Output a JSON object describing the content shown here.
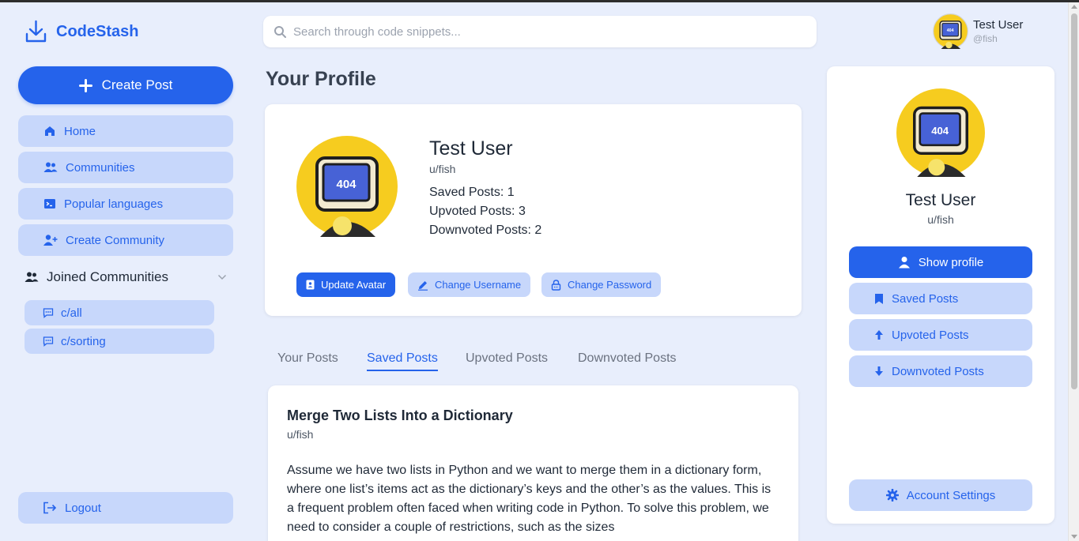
{
  "app": {
    "name": "CodeStash"
  },
  "sidebar": {
    "create_post": "Create Post",
    "nav": [
      {
        "label": "Home",
        "icon": "home-icon"
      },
      {
        "label": "Communities",
        "icon": "users-icon"
      },
      {
        "label": "Popular languages",
        "icon": "terminal-icon"
      },
      {
        "label": "Create Community",
        "icon": "user-plus-icon"
      }
    ],
    "joined_title": "Joined Communities",
    "communities": [
      "c/all",
      "c/sorting"
    ],
    "logout": "Logout"
  },
  "search": {
    "placeholder": "Search through code snippets..."
  },
  "top_user": {
    "name": "Test User",
    "handle": "@fish"
  },
  "page_title": "Your Profile",
  "profile": {
    "name": "Test User",
    "handle": "u/fish",
    "saved": "Saved Posts: 1",
    "upvoted": "Upvoted Posts: 3",
    "downvoted": "Downvoted Posts: 2",
    "update_avatar": "Update Avatar",
    "change_username": "Change Username",
    "change_password": "Change Password"
  },
  "tabs": [
    "Your Posts",
    "Saved Posts",
    "Upvoted Posts",
    "Downvoted Posts"
  ],
  "active_tab": "Saved Posts",
  "post": {
    "title": "Merge Two Lists Into a Dictionary",
    "author": "u/fish",
    "body": "Assume we have two lists in Python and we want to merge them in a dictionary form, where one list’s items act as the dictionary’s keys and the other’s as the values. This is a frequent problem often faced when writing code in Python. To solve this problem, we need to consider a couple of restrictions, such as the sizes"
  },
  "right_panel": {
    "name": "Test User",
    "handle": "u/fish",
    "show_profile": "Show profile",
    "saved_posts": "Saved Posts",
    "upvoted_posts": "Upvoted Posts",
    "downvoted_posts": "Downvoted Posts",
    "account_settings": "Account Settings"
  },
  "avatar_text": "404",
  "colors": {
    "accent": "#2563eb",
    "soft": "#c7d7fb",
    "background": "#e8eefc",
    "avatar_bg": "#f6cc1f"
  }
}
